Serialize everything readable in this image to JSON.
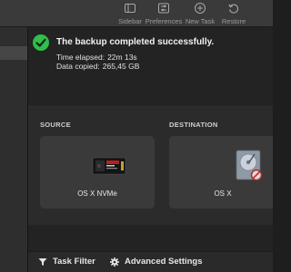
{
  "toolbar": {
    "sidebar_label": "Sidebar",
    "preferences_label": "Preferences",
    "new_task_label": "New Task",
    "restore_label": "Restore"
  },
  "status": {
    "title": "The backup completed successfully.",
    "time_elapsed_label": "Time elapsed:",
    "time_elapsed_value": "22m 13s",
    "data_copied_label": "Data copied:",
    "data_copied_value": "265,45 GB",
    "accent_color": "#2fbf4a"
  },
  "source": {
    "label": "SOURCE",
    "drive_name": "OS X NVMe",
    "icon": "nvme-ssd-icon"
  },
  "destination": {
    "label": "DESTINATION",
    "drive_name": "OS X",
    "icon": "hard-drive-icon"
  },
  "footer": {
    "task_filter_label": "Task Filter",
    "advanced_settings_label": "Advanced Settings"
  }
}
